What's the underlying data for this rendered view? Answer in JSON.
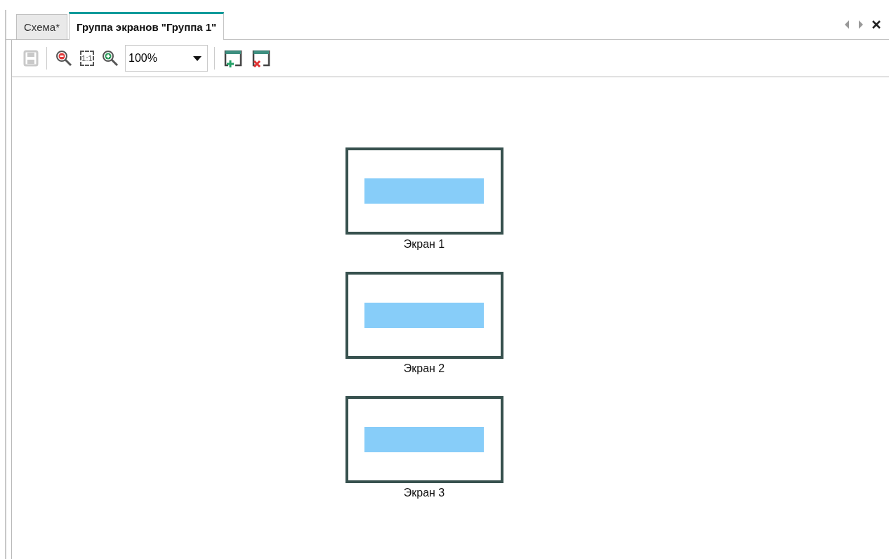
{
  "tabs": [
    {
      "label": "Схема*",
      "selected": false
    },
    {
      "label": "Группа экранов \"Группа 1\"",
      "selected": true
    }
  ],
  "toolbar": {
    "items": [
      {
        "kind": "save",
        "disabled": true
      },
      {
        "kind": "separator"
      },
      {
        "kind": "zoom-out",
        "disabled": false
      },
      {
        "kind": "actual-size",
        "label": "1:1",
        "disabled": false
      },
      {
        "kind": "zoom-in",
        "disabled": false
      },
      {
        "kind": "zoom-select",
        "value": "100%"
      },
      {
        "kind": "separator"
      },
      {
        "kind": "add-screen",
        "disabled": false
      },
      {
        "kind": "remove-screen",
        "disabled": false
      }
    ]
  },
  "screens": [
    {
      "label": "Экран 1"
    },
    {
      "label": "Экран 2"
    },
    {
      "label": "Экран 3"
    }
  ]
}
